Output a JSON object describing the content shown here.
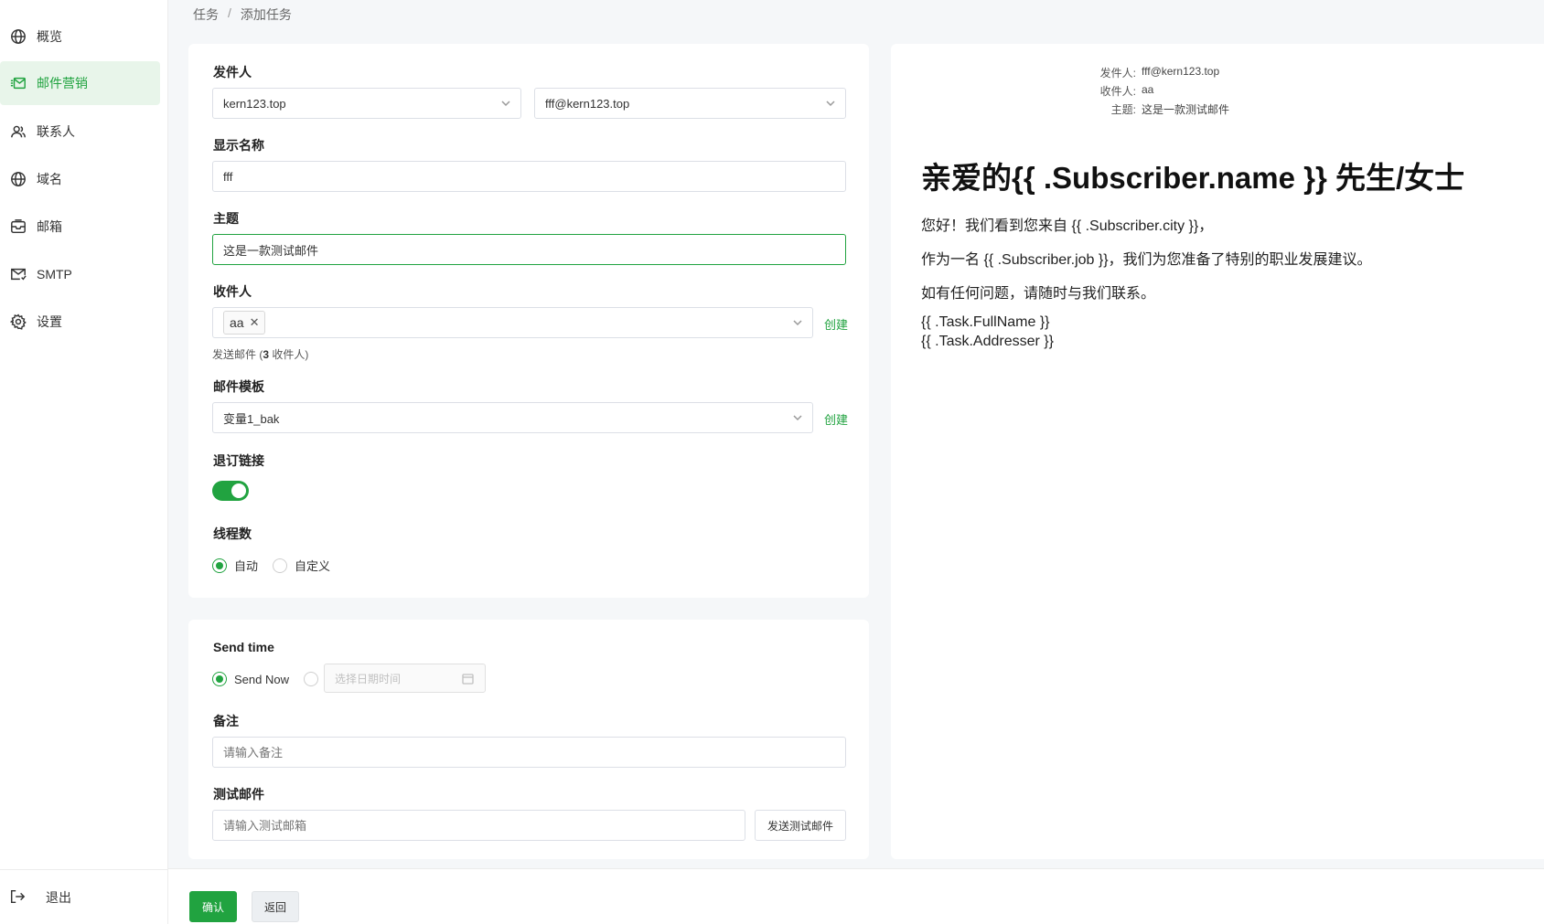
{
  "sidebar": {
    "items": [
      {
        "label": "概览",
        "icon": "globe-icon"
      },
      {
        "label": "邮件营销",
        "icon": "mail-marketing-icon"
      },
      {
        "label": "联系人",
        "icon": "contacts-icon"
      },
      {
        "label": "域名",
        "icon": "globe-icon"
      },
      {
        "label": "邮箱",
        "icon": "mailbox-icon"
      },
      {
        "label": "SMTP",
        "icon": "smtp-mail-icon"
      },
      {
        "label": "设置",
        "icon": "gear-icon"
      }
    ],
    "logout": "退出"
  },
  "breadcrumb": {
    "parent": "任务",
    "separator": "/",
    "current": "添加任务"
  },
  "form": {
    "sender_label": "发件人",
    "sender_domain": "kern123.top",
    "sender_address": "fff@kern123.top",
    "display_name_label": "显示名称",
    "display_name_value": "fff",
    "subject_label": "主题",
    "subject_value": "这是一款测试邮件",
    "recipients_label": "收件人",
    "recipient_tag": "aa",
    "create_label": "创建",
    "recipients_hint_prefix": "发送邮件 (",
    "recipients_hint_count": "3",
    "recipients_hint_suffix": " 收件人)",
    "template_label": "邮件模板",
    "template_value": "变量1_bak",
    "unsubscribe_label": "退订链接",
    "threads_label": "线程数",
    "thread_auto": "自动",
    "thread_custom": "自定义"
  },
  "schedule": {
    "send_time_label": "Send time",
    "send_now": "Send Now",
    "datetime_placeholder": "选择日期时间",
    "note_label": "备注",
    "note_placeholder": "请输入备注",
    "test_label": "测试邮件",
    "test_placeholder": "请输入测试邮箱",
    "test_button": "发送测试邮件"
  },
  "preview": {
    "from_key": "发件人:",
    "from_val": "fff@kern123.top",
    "to_key": "收件人:",
    "to_val": "aa",
    "subject_key": "主题:",
    "subject_val": "这是一款测试邮件",
    "title": "亲爱的{{ .Subscriber.name }} 先生/女士",
    "line1": "您好！我们看到您来自 {{ .Subscriber.city }}，",
    "line2": "作为一名 {{ .Subscriber.job }}，我们为您准备了特别的职业发展建议。",
    "line3": "如有任何问题，请随时与我们联系。",
    "line4": "{{ .Task.FullName }}",
    "line5": "{{ .Task.Addresser }}"
  },
  "footer": {
    "confirm": "确认",
    "back": "返回"
  },
  "colors": {
    "accent": "#21a340",
    "active_bg": "#e8f5ea"
  }
}
